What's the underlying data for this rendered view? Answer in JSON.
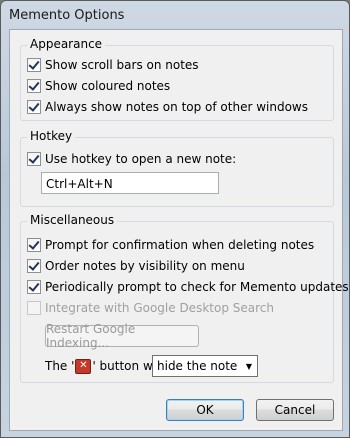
{
  "window": {
    "title": "Memento Options"
  },
  "appearance": {
    "label": "Appearance",
    "options": [
      {
        "label": "Show scroll bars on notes",
        "checked": true
      },
      {
        "label": "Show coloured notes",
        "checked": true
      },
      {
        "label": "Always show notes on top of other windows",
        "checked": true
      }
    ]
  },
  "hotkey": {
    "label": "Hotkey",
    "use_hotkey_label": "Use hotkey to open a new note:",
    "use_hotkey_checked": true,
    "value": "Ctrl+Alt+N"
  },
  "misc": {
    "label": "Miscellaneous",
    "options": [
      {
        "label": "Prompt for confirmation when deleting notes",
        "checked": true
      },
      {
        "label": "Order notes by visibility on menu",
        "checked": true
      },
      {
        "label": "Periodically prompt to check for Memento updates",
        "checked": true
      },
      {
        "label": "Integrate with Google Desktop Search",
        "checked": false,
        "disabled": true
      }
    ],
    "restart_button": "Restart Google Indexing...",
    "button_will_prefix": "The '",
    "button_will_suffix": "' button will",
    "close_behavior_value": "hide the note",
    "red_x_glyph": "✕"
  },
  "footer": {
    "ok_label": "OK",
    "cancel_label": "Cancel"
  }
}
